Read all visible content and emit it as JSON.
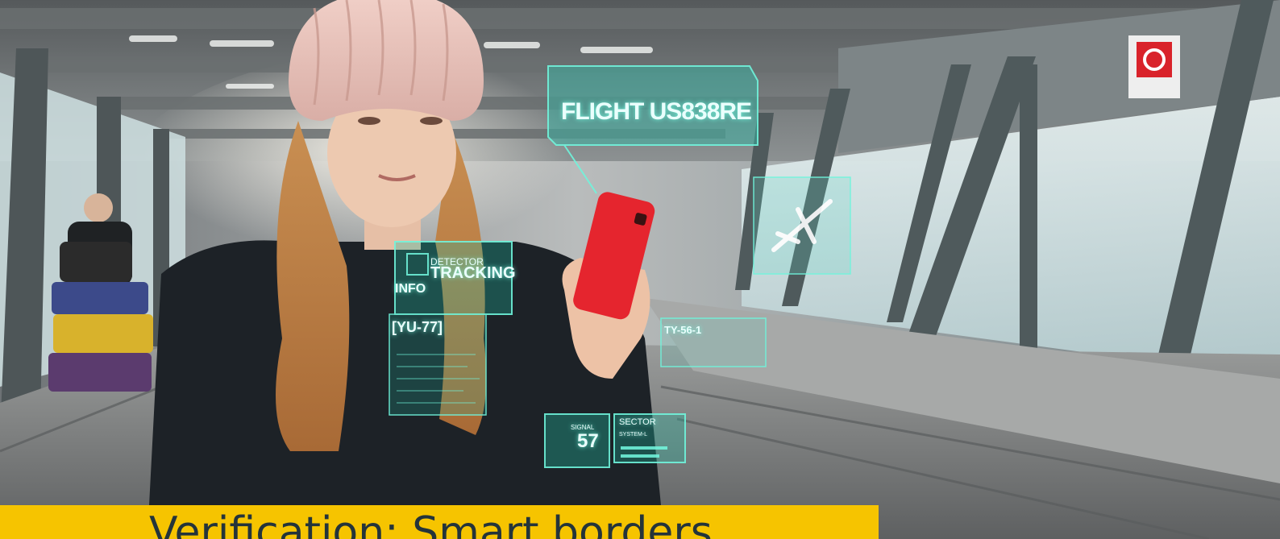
{
  "hud": {
    "flight_label": "FLIGHT US838RE",
    "detector_label": "DETECTOR",
    "tracking_label": "TRACKING",
    "info_label": "INFO",
    "code_label": "[YU-77]",
    "ty_label": "TY-56-1",
    "signal_label": "SIGNAL",
    "signal_value": "57",
    "sector_label": "SECTOR",
    "system_label": "SYSTEM-L"
  },
  "banner": {
    "title": "Verification: Smart borders"
  },
  "colors": {
    "banner_bg": "#f6c400",
    "banner_text": "#24343a",
    "hud_glow": "#5fffe0",
    "phone_red": "#e5252e"
  }
}
